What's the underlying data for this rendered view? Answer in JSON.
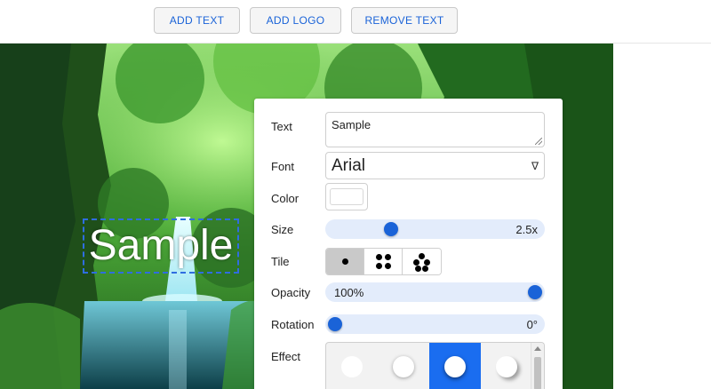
{
  "toolbar": {
    "add_text": "ADD TEXT",
    "add_logo": "ADD LOGO",
    "remove_text": "REMOVE TEXT"
  },
  "watermark": {
    "text": "Sample",
    "color": "#ffffff",
    "selection_color": "#2f6de0"
  },
  "panel": {
    "text_label": "Text",
    "text_value": "Sample",
    "font_label": "Font",
    "font_value": "Arial",
    "font_caret": "∇",
    "color_label": "Color",
    "color_value": "#ffffff",
    "size_label": "Size",
    "size_value": "2.5x",
    "size_level": 0.28,
    "tile_label": "Tile",
    "tile_options": [
      "single",
      "four-dots",
      "five-dots"
    ],
    "tile_selected": "single",
    "opacity_label": "Opacity",
    "opacity_value": "100%",
    "opacity_level": 1.0,
    "rotation_label": "Rotation",
    "rotation_value": "0°",
    "rotation_level": 0.0,
    "effect_label": "Effect",
    "effects": [
      "flat",
      "shadow-soft",
      "shadow-selected",
      "shadow-offset"
    ],
    "effect_selected": 2
  },
  "colors": {
    "accent": "#1a63d8",
    "slider_track": "#e3ecfb",
    "effect_selected": "#1a6df0"
  }
}
